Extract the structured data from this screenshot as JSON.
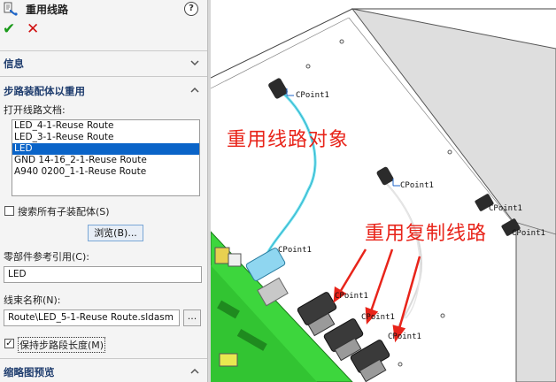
{
  "header": {
    "title": "重用线路",
    "help_icon": "?",
    "ok_icon": "check-icon",
    "cancel_icon": "close-icon"
  },
  "sections": {
    "info": "信息",
    "step": "步路装配体以重用",
    "open_docs_label": "打开线路文档:",
    "thumb_preview": "缩略图预览"
  },
  "route_list": [
    {
      "label": "LED_4-1-Reuse Route",
      "selected": false
    },
    {
      "label": "LED_3-1-Reuse Route",
      "selected": false
    },
    {
      "label": "LED",
      "selected": true
    },
    {
      "label": "GND 14-16_2-1-Reuse Route",
      "selected": false
    },
    {
      "label": "A940 0200_1-1-Reuse Route",
      "selected": false
    }
  ],
  "search_subassemblies": {
    "label": "搜索所有子装配体(S)",
    "checked": false
  },
  "browse_button": "浏览(B)...",
  "component_ref": {
    "label": "零部件参考引用(C):",
    "value": "LED"
  },
  "harness_name": {
    "label": "线束名称(N):",
    "value": "Route\\LED_5-1-Reuse Route.sldasm",
    "browse": "..."
  },
  "keep_segment_length": {
    "label": "保持步路段长度(M)",
    "checked": true
  },
  "viewport": {
    "annotation_reuse_target": "重用线路对象",
    "annotation_reuse_copy": "重用复制线路",
    "cpoint_label": "CPoint1",
    "accent_color": "#e8241a",
    "board_color": "#3dd63d"
  }
}
